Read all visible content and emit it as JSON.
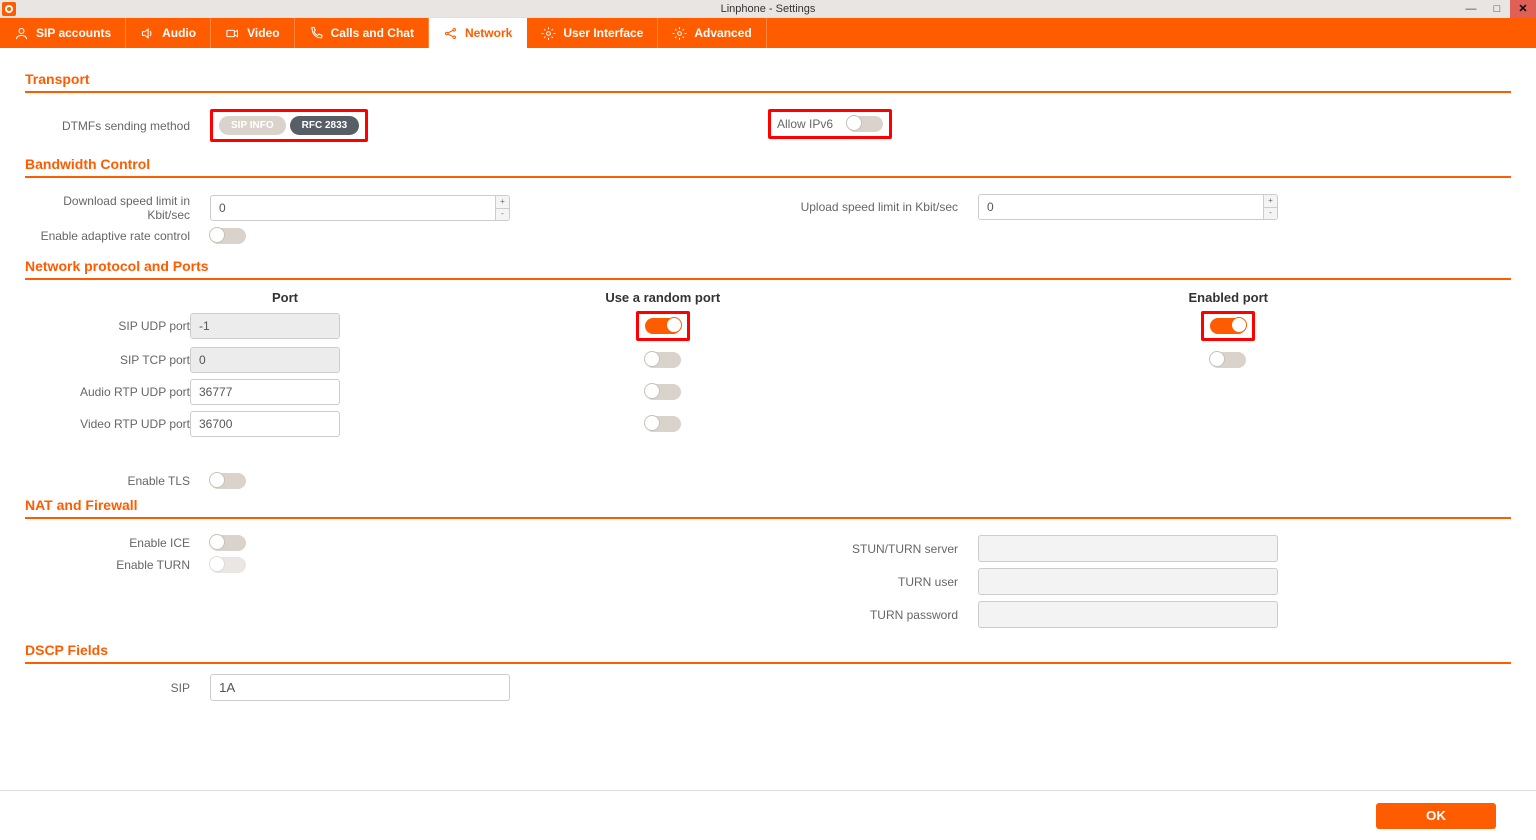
{
  "window": {
    "title": "Linphone - Settings"
  },
  "tabs": {
    "sip": "SIP accounts",
    "audio": "Audio",
    "video": "Video",
    "calls": "Calls and Chat",
    "network": "Network",
    "ui": "User Interface",
    "advanced": "Advanced"
  },
  "transport": {
    "heading": "Transport",
    "dtmf_label": "DTMFs sending method",
    "dtmf_sipinfo": "SIP INFO",
    "dtmf_rfc": "RFC 2833",
    "ipv6_label": "Allow IPv6"
  },
  "bandwidth": {
    "heading": "Bandwidth Control",
    "download_label": "Download speed limit in Kbit/sec",
    "download_value": "0",
    "upload_label": "Upload speed limit in Kbit/sec",
    "upload_value": "0",
    "adaptive_label": "Enable adaptive rate control"
  },
  "protoports": {
    "heading": "Network protocol and Ports",
    "col_port": "Port",
    "col_random": "Use a random port",
    "col_enabled": "Enabled port",
    "rows": {
      "sip_udp": {
        "label": "SIP UDP port",
        "value": "-1"
      },
      "sip_tcp": {
        "label": "SIP TCP port",
        "value": "0"
      },
      "audio_rtp": {
        "label": "Audio RTP UDP port",
        "value": "36777"
      },
      "video_rtp": {
        "label": "Video RTP UDP port",
        "value": "36700"
      }
    },
    "tls_label": "Enable TLS"
  },
  "nat": {
    "heading": "NAT and Firewall",
    "ice_label": "Enable ICE",
    "turn_label": "Enable TURN",
    "stunserver_label": "STUN/TURN server",
    "turnuser_label": "TURN user",
    "turnpass_label": "TURN password"
  },
  "dscp": {
    "heading": "DSCP Fields",
    "sip_label": "SIP",
    "sip_value": "1A"
  },
  "footer": {
    "ok": "OK"
  }
}
